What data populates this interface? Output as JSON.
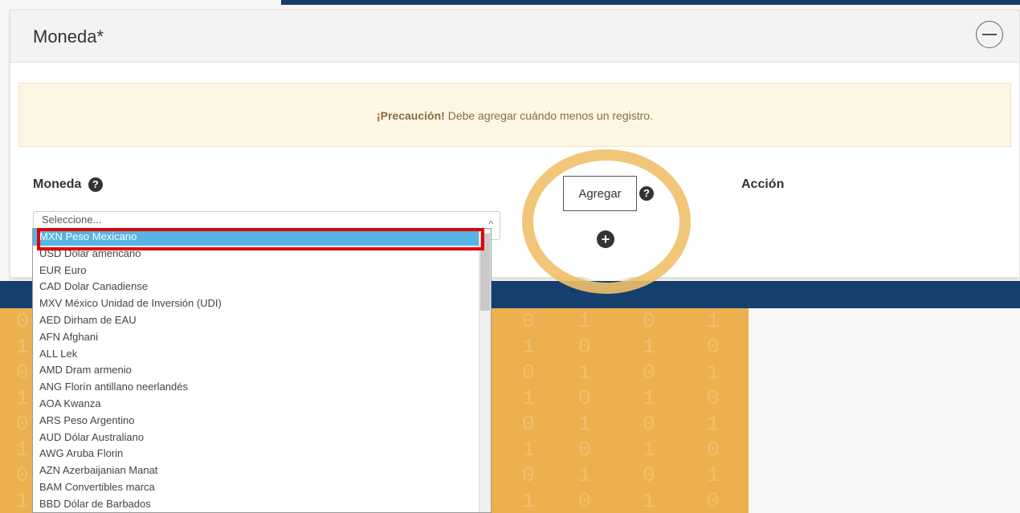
{
  "panel": {
    "title": "Moneda*"
  },
  "alert": {
    "strong": "¡Precaución!",
    "text": "Debe agregar cuándo menos un registro."
  },
  "form": {
    "moneda_label": "Moneda",
    "accion_label": "Acción",
    "help_glyph": "?",
    "select_placeholder": "Seleccione...",
    "agregar_tooltip": "Agregar"
  },
  "dropdown": {
    "options": [
      "MXN Peso Mexicano",
      "USD Dolar americano",
      "EUR Euro",
      "CAD Dolar Canadiense",
      "MXV México Unidad de Inversión (UDI)",
      "AED Dirham de EAU",
      "AFN Afghani",
      "ALL Lek",
      "AMD Dram armenio",
      "ANG Florín antillano neerlandés",
      "AOA Kwanza",
      "ARS Peso Argentino",
      "AUD Dólar Australiano",
      "AWG Aruba Florin",
      "AZN Azerbaijanian Manat",
      "BAM Convertibles marca",
      "BBD Dólar de Barbados"
    ],
    "selected_index": 0
  },
  "icons": {
    "collapse": "minus-circle-icon",
    "help": "question-circle-icon",
    "add": "plus-circle-icon"
  },
  "colors": {
    "header_blue": "#153d6b",
    "accent_orange": "#ecb14e",
    "highlight_red": "#e10000",
    "selected_option": "#55b4e3",
    "alert_bg": "#fcf7e4"
  }
}
